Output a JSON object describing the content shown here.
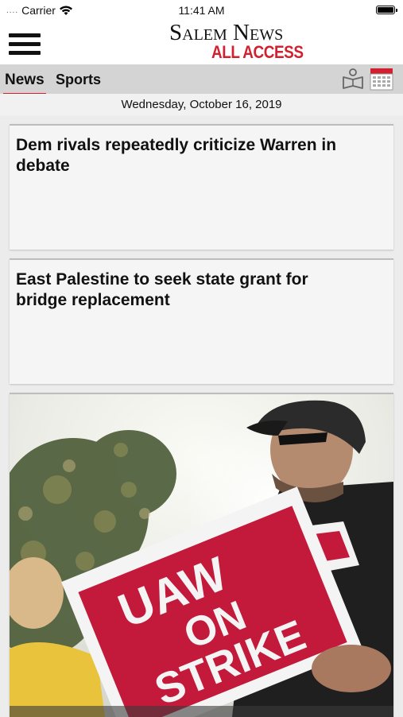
{
  "status_bar": {
    "signal_dots": "....",
    "carrier": "Carrier",
    "time": "11:41 AM",
    "icons": [
      "wifi-icon",
      "battery-icon"
    ]
  },
  "header": {
    "menu_icon": "hamburger-menu-icon",
    "logo_line1": "Salem News",
    "logo_line2": "ALL ACCESS"
  },
  "tabs": {
    "items": [
      {
        "label": "News",
        "active": true
      },
      {
        "label": "Sports",
        "active": false
      }
    ],
    "icons": [
      "e-edition-reader-icon",
      "calendar-icon"
    ]
  },
  "date": "Wednesday, October 16, 2019",
  "articles": [
    {
      "headline": "Dem rivals repeatedly criticize Warren in debate"
    },
    {
      "headline": "East Palestine to seek state grant for bridge replacement"
    },
    {
      "headline": "",
      "image": "photo of a man holding a strike picket sign",
      "sign_text": [
        "UAW",
        "ON",
        "STRIKE"
      ]
    }
  ],
  "colors": {
    "accent_red": "#d1202f",
    "tab_bar": "#d4d4d4",
    "card_bg": "#f5f5f5"
  }
}
